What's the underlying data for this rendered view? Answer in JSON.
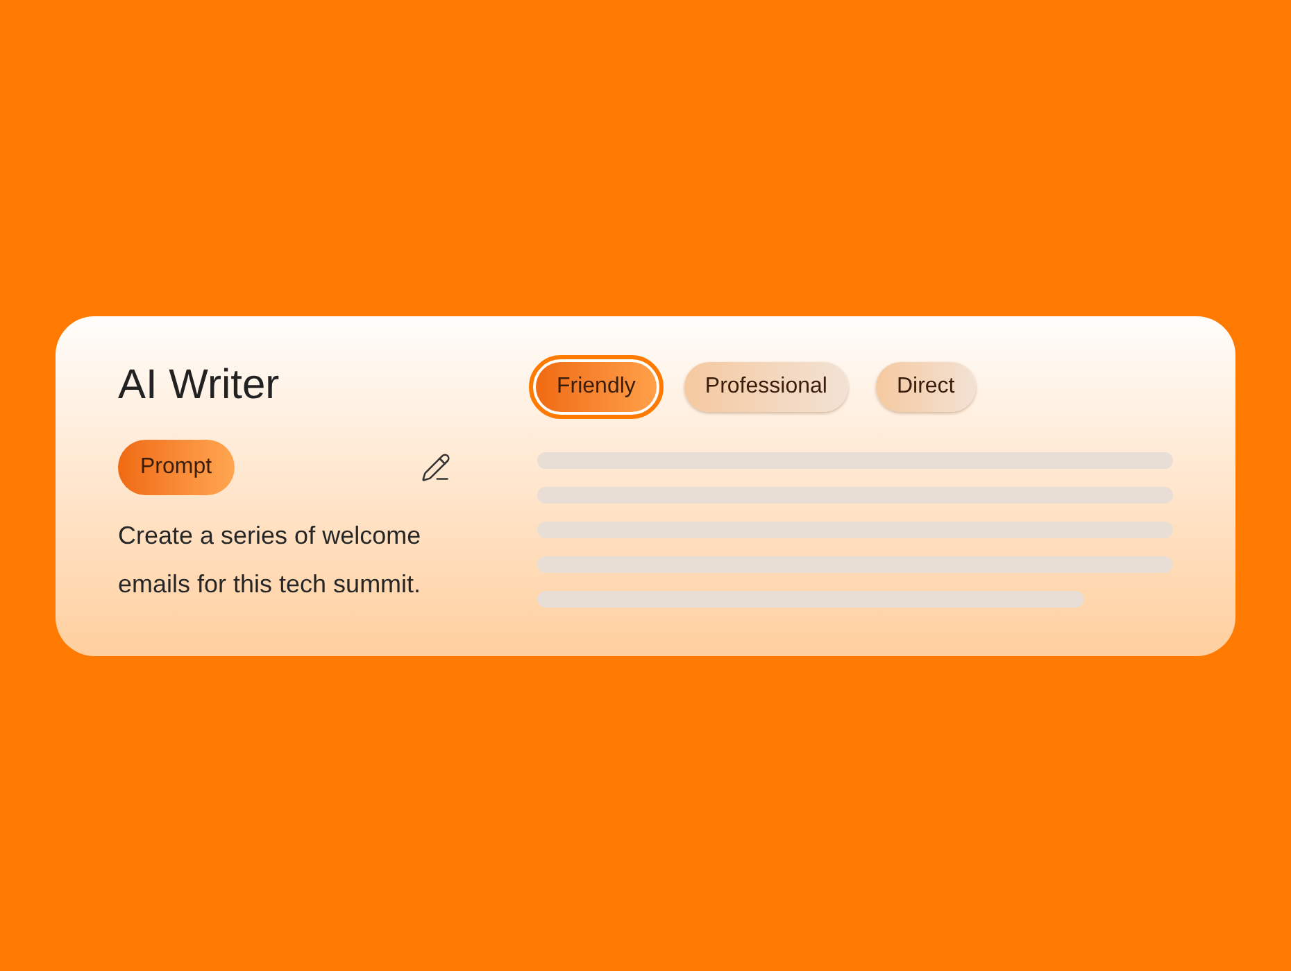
{
  "title": "AI Writer",
  "prompt": {
    "label": "Prompt",
    "text": "Create a series of welcome emails for this tech summit."
  },
  "tones": [
    {
      "label": "Friendly",
      "selected": true
    },
    {
      "label": "Professional",
      "selected": false
    },
    {
      "label": "Direct",
      "selected": false
    }
  ]
}
